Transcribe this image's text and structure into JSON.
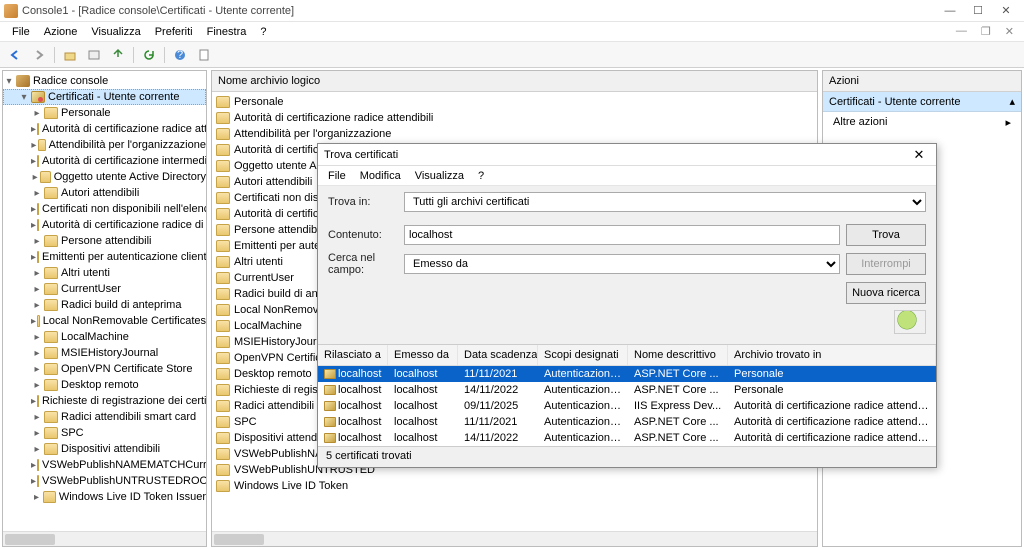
{
  "title": "Console1 - [Radice console\\Certificati - Utente corrente]",
  "menu": {
    "file": "File",
    "azione": "Azione",
    "visualizza": "Visualizza",
    "preferiti": "Preferiti",
    "finestra": "Finestra",
    "help": "?"
  },
  "tree": {
    "root": "Radice console",
    "cert_root": "Certificati - Utente corrente",
    "items": [
      "Personale",
      "Autorità di certificazione radice attendibili",
      "Attendibilità per l'organizzazione",
      "Autorità di certificazione intermedie",
      "Oggetto utente Active Directory",
      "Autori attendibili",
      "Certificati non disponibili nell'elenco locale",
      "Autorità di certificazione radice di terze parti",
      "Persone attendibili",
      "Emittenti per autenticazione client",
      "Altri utenti",
      "CurrentUser",
      "Radici build di anteprima",
      "Local NonRemovable Certificates",
      "LocalMachine",
      "MSIEHistoryJournal",
      "OpenVPN Certificate Store",
      "Desktop remoto",
      "Richieste di registrazione dei certificati",
      "Radici attendibili smart card",
      "SPC",
      "Dispositivi attendibili",
      "VSWebPublishNAMEMATCHCurrentUser",
      "VSWebPublishUNTRUSTEDROOTCurrentUser",
      "Windows Live ID Token Issuer"
    ]
  },
  "center": {
    "header": "Nome archivio logico",
    "items": [
      "Personale",
      "Autorità di certificazione radice attendibili",
      "Attendibilità per l'organizzazione",
      "Autorità di certificazione intermedie",
      "Oggetto utente Active Directory",
      "Autori attendibili",
      "Certificati non disponibili",
      "Autorità di certificazione",
      "Persone attendibili",
      "Emittenti per autenticazione",
      "Altri utenti",
      "CurrentUser",
      "Radici build di anteprima",
      "Local NonRemovable",
      "LocalMachine",
      "MSIEHistoryJournal",
      "OpenVPN Certificate",
      "Desktop remoto",
      "Richieste di registrazione",
      "Radici attendibili smart",
      "SPC",
      "Dispositivi attendibili",
      "VSWebPublishNAMEMATCH",
      "VSWebPublishUNTRUSTED",
      "Windows Live ID Token"
    ]
  },
  "actions": {
    "header": "Azioni",
    "bar": "Certificati - Utente corrente",
    "more": "Altre azioni"
  },
  "dialog": {
    "title": "Trova certificati",
    "menu": {
      "file": "File",
      "modifica": "Modifica",
      "visualizza": "Visualizza",
      "help": "?"
    },
    "labels": {
      "trovain": "Trova in:",
      "contenuto": "Contenuto:",
      "cerca": "Cerca nel campo:"
    },
    "trovain_value": "Tutti gli archivi certificati",
    "contenuto_value": "localhost",
    "cerca_value": "Emesso da",
    "buttons": {
      "trova": "Trova",
      "interrompi": "Interrompi",
      "nuova": "Nuova ricerca"
    },
    "cols": [
      "Rilasciato a",
      "Emesso da",
      "Data scadenza",
      "Scopi designati",
      "Nome descrittivo",
      "Archivio trovato in"
    ],
    "rows": [
      {
        "c": [
          "localhost",
          "localhost",
          "11/11/2021",
          "Autenticazione s...",
          "ASP.NET Core ...",
          "Personale"
        ],
        "sel": true
      },
      {
        "c": [
          "localhost",
          "localhost",
          "14/11/2022",
          "Autenticazione s...",
          "ASP.NET Core ...",
          "Personale"
        ],
        "sel": false
      },
      {
        "c": [
          "localhost",
          "localhost",
          "09/11/2025",
          "Autenticazione s...",
          "IIS Express Dev...",
          "Autorità di certificazione radice attendibili"
        ],
        "sel": false
      },
      {
        "c": [
          "localhost",
          "localhost",
          "11/11/2021",
          "Autenticazione s...",
          "ASP.NET Core ...",
          "Autorità di certificazione radice attendibili"
        ],
        "sel": false
      },
      {
        "c": [
          "localhost",
          "localhost",
          "14/11/2022",
          "Autenticazione s...",
          "ASP.NET Core ...",
          "Autorità di certificazione radice attendibili"
        ],
        "sel": false
      }
    ],
    "status": "5 certificati trovati"
  }
}
